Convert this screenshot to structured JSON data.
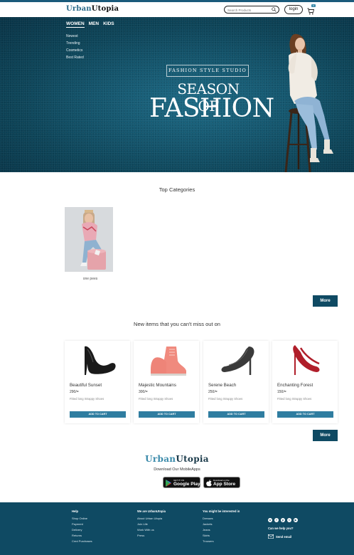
{
  "header": {
    "logo_part1": "Urban",
    "logo_part2": "Utopia",
    "search_placeholder": "Search Products",
    "login_label": "login",
    "cart_count": "0"
  },
  "hero": {
    "nav": [
      "WOMEN",
      "MEN",
      "KIDS"
    ],
    "submenu": [
      "Newest",
      "Trending",
      "Cosmetics",
      "Best Rated"
    ],
    "studio": "FASHION STYLE STUDIO",
    "line1": "SEASON OF",
    "line2": "FASHION"
  },
  "categories": {
    "title": "Top Categories",
    "items": [
      {
        "label": "one pees"
      }
    ],
    "more": "More"
  },
  "new_items": {
    "title": "New items that you can't miss out on",
    "more": "More",
    "products": [
      {
        "name": "Beautiful Sunset",
        "price": "290/=",
        "desc": "Fitted long Strappy Shoes",
        "cta": "ADD TO CART",
        "color": "#1a1a1a"
      },
      {
        "name": "Majestic Mountains",
        "price": "300/=",
        "desc": "Fitted long Strappy Shoes",
        "cta": "ADD TO CART",
        "color": "#f08a7e"
      },
      {
        "name": "Serene Beach",
        "price": "250/=",
        "desc": "Fitted long Strappy Shoes",
        "cta": "ADD TO CART",
        "color": "#3a3a3a"
      },
      {
        "name": "Enchanting Forest",
        "price": "150/=",
        "desc": "Fitted long Strappy Shoes",
        "cta": "ADD TO CART",
        "color": "#b01e2a"
      }
    ]
  },
  "app": {
    "brand_part1": "Urban",
    "brand_part2": "Utopia",
    "download_text": "Download Our MobileApps",
    "google_small": "GET IT ON",
    "google_big": "Google Play",
    "apple_small": "Download on the",
    "apple_big": "App Store"
  },
  "footer": {
    "columns": [
      {
        "heading": "Help",
        "items": [
          "Shop Online",
          "Payment",
          "Delivery",
          "Returns",
          "Cred Purchases"
        ]
      },
      {
        "heading": "We are UrbanUtopia",
        "items": [
          "About Urban Utopia",
          "Join Life",
          "Work With us",
          "Press"
        ]
      },
      {
        "heading": "You might be interested in",
        "items": [
          "Dresses",
          "Jackets",
          "Jeans",
          "Skirts",
          "Trousers"
        ]
      }
    ],
    "help_question": "Can we help you?",
    "email_label": "Send email"
  },
  "colors": {
    "primary": "#0f4a63",
    "accent": "#2f7da0",
    "hero": "#14566e"
  }
}
